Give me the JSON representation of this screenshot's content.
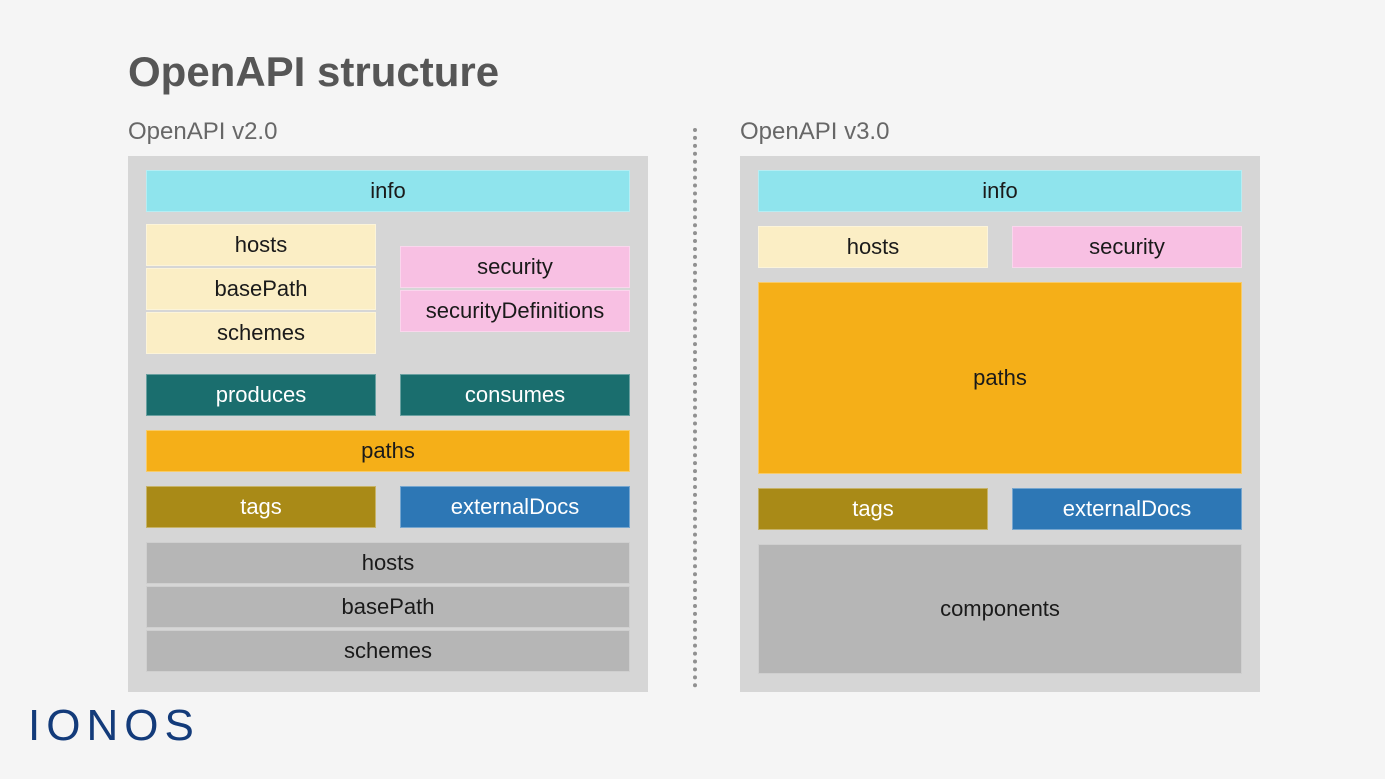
{
  "title": "OpenAPI structure",
  "logo": "IONOS",
  "v2": {
    "heading": "OpenAPI v2.0",
    "info": "info",
    "hosts": "hosts",
    "basePath": "basePath",
    "schemes": "schemes",
    "security": "security",
    "securityDefinitions": "securityDefinitions",
    "produces": "produces",
    "consumes": "consumes",
    "paths": "paths",
    "tags": "tags",
    "externalDocs": "externalDocs",
    "footer_hosts": "hosts",
    "footer_basePath": "basePath",
    "footer_schemes": "schemes"
  },
  "v3": {
    "heading": "OpenAPI v3.0",
    "info": "info",
    "hosts": "hosts",
    "security": "security",
    "paths": "paths",
    "tags": "tags",
    "externalDocs": "externalDocs",
    "components": "components"
  }
}
